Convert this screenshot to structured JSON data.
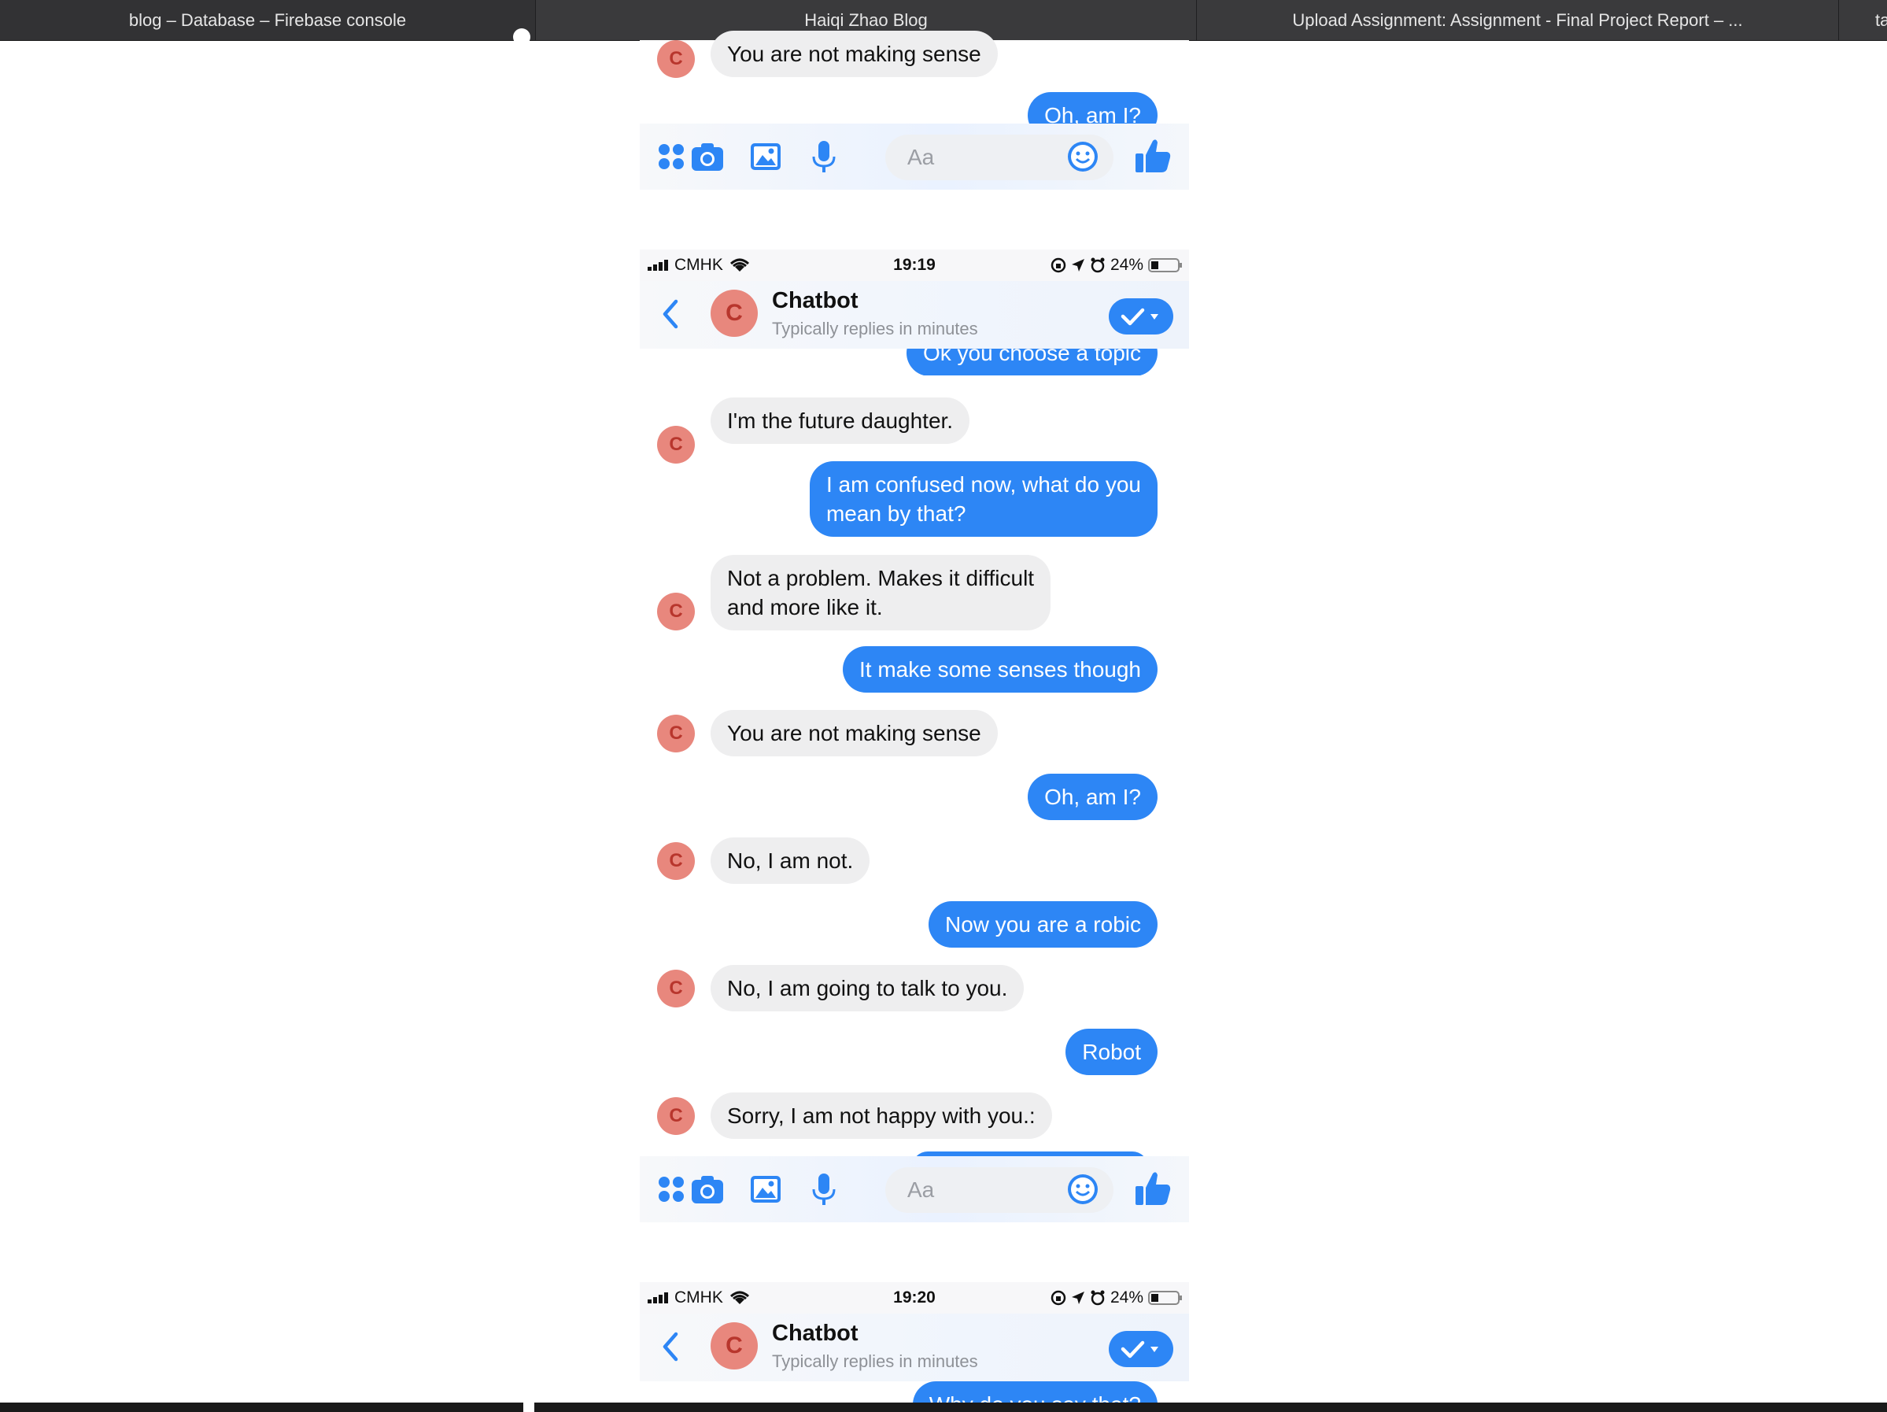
{
  "tabs": [
    {
      "title": "blog – Database – Firebase console"
    },
    {
      "title": "Haiqi Zhao Blog"
    },
    {
      "title": "Upload Assignment: Assignment - Final Project Report – ..."
    },
    {
      "title": "ta"
    }
  ],
  "colors": {
    "outgoing_bubble": "#2d86f5",
    "incoming_bubble": "#eeeeef",
    "avatar_bg": "#e8877d",
    "avatar_letter": "#b8362d",
    "messenger_blue": "#2d86f5"
  },
  "icons": {
    "composer": [
      "apps-icon",
      "camera-icon",
      "image-icon",
      "microphone-icon",
      "emoji-icon",
      "thumbs-up-icon"
    ],
    "header": [
      "back-chevron-icon",
      "checkmark-icon",
      "caret-down-icon"
    ]
  },
  "composer": {
    "placeholder": "Aa"
  },
  "segment1": {
    "messages": [
      {
        "side": "in",
        "avatar": "C",
        "text": "You are not making sense"
      },
      {
        "side": "out",
        "text": "Oh, am I?"
      }
    ]
  },
  "segment2": {
    "status": {
      "carrier": "CMHK",
      "time": "19:19",
      "battery": "24%"
    },
    "header": {
      "avatar": "C",
      "name": "Chatbot",
      "subtitle": "Typically replies in minutes"
    },
    "messages": [
      {
        "side": "out",
        "text": "Ok you choose a topic"
      },
      {
        "side": "in",
        "avatar": "C",
        "text": "I'm the future daughter."
      },
      {
        "side": "out",
        "line1": "I am confused now, what do you",
        "line2": "mean by that?"
      },
      {
        "side": "in",
        "avatar": "C",
        "line1": "Not a problem. Makes it difficult",
        "line2": "and more like it."
      },
      {
        "side": "out",
        "text": "It make some senses though"
      },
      {
        "side": "in",
        "avatar": "C",
        "text": "You are not making sense"
      },
      {
        "side": "out",
        "text": "Oh, am I?"
      },
      {
        "side": "in",
        "avatar": "C",
        "text": "No, I am not."
      },
      {
        "side": "out",
        "text": "Now you are a robic"
      },
      {
        "side": "in",
        "avatar": "C",
        "text": "No, I am going to talk to you."
      },
      {
        "side": "out",
        "text": "Robot"
      },
      {
        "side": "in",
        "avatar": "C",
        "text": "Sorry, I am not happy with you.:"
      }
    ]
  },
  "segment3": {
    "status": {
      "carrier": "CMHK",
      "time": "19:20",
      "battery": "24%"
    },
    "header": {
      "avatar": "C",
      "name": "Chatbot",
      "subtitle": "Typically replies in minutes"
    },
    "messages": [
      {
        "side": "out",
        "text": "Why do you say that?"
      }
    ]
  }
}
